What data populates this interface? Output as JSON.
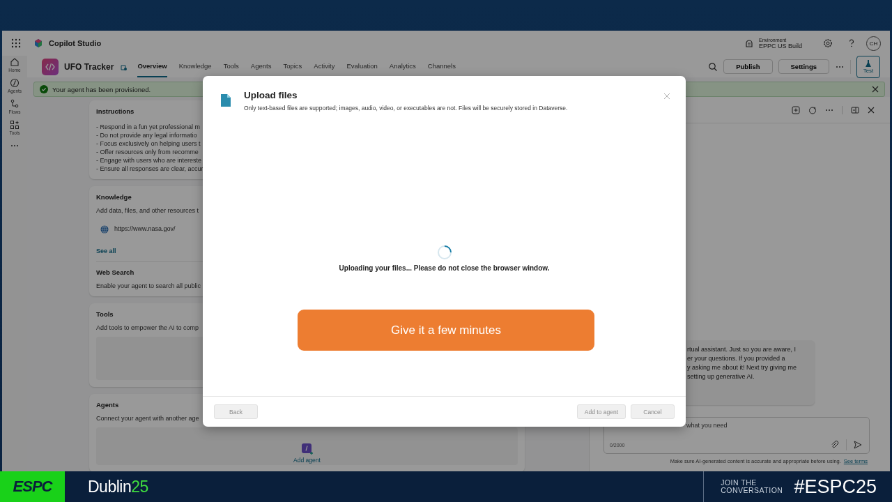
{
  "app_bar": {
    "title": "Copilot Studio",
    "environment_label": "Environment",
    "environment": "EPPC US Build",
    "avatar": "CH"
  },
  "rail": [
    {
      "label": "Home"
    },
    {
      "label": "Agents"
    },
    {
      "label": "Flows"
    },
    {
      "label": "Tools"
    }
  ],
  "agent": {
    "name": "UFO Tracker"
  },
  "tabs": [
    {
      "label": "Overview",
      "selected": true
    },
    {
      "label": "Knowledge",
      "selected": false
    },
    {
      "label": "Tools",
      "selected": false
    },
    {
      "label": "Agents",
      "selected": false
    },
    {
      "label": "Topics",
      "selected": false
    },
    {
      "label": "Activity",
      "selected": false
    },
    {
      "label": "Evaluation",
      "selected": false
    },
    {
      "label": "Analytics",
      "selected": false
    },
    {
      "label": "Channels",
      "selected": false
    }
  ],
  "toolbar": {
    "buttons": [
      "Publish",
      "Settings"
    ],
    "test": "Test"
  },
  "notice": {
    "text": "Your agent has been provisioned."
  },
  "instructions": {
    "title": "Instructions",
    "lines": [
      "- Respond in a fun yet professional m",
      "- Do not provide any legal informatio",
      "- Focus exclusively on helping users t",
      "- Offer resources only from recomme",
      "- Engage with users who are intereste",
      "- Ensure all responses are clear, accur"
    ]
  },
  "knowledge": {
    "title": "Knowledge",
    "description": "Add data, files, and other resources t",
    "source": "https://www.nasa.gov/",
    "link": "See all"
  },
  "web_search": {
    "title": "Web Search",
    "description": "Enable your agent to search all public"
  },
  "tools": {
    "title": "Tools",
    "description": "Add tools to empower the AI to comp"
  },
  "agents": {
    "title": "Agents",
    "description": "Connect your agent with another age",
    "add": "Add agent"
  },
  "chat": {
    "message_lines": [
      "rtual assistant. Just so you are aware, I",
      "er your questions. If you provided a",
      "y asking me about it! Next try giving me",
      "setting up generative AI."
    ],
    "placeholder": "what you need",
    "counter": "0/2000",
    "disclaimer": "Make sure AI-generated content is accurate and appropriate before using.",
    "terms": "See terms"
  },
  "dialog": {
    "title": "Upload files",
    "subtitle": "Only text-based files are supported; images, audio, video, or executables are not. Files will be securely stored in Dataverse.",
    "status": "Uploading your files... Please do not close the browser window.",
    "buttons": [
      {
        "label": "Back",
        "disabled": true
      },
      {
        "label": "Add to agent",
        "disabled": true
      },
      {
        "label": "Cancel",
        "disabled": true
      }
    ]
  },
  "callout": {
    "text": "Give it a few minutes"
  },
  "banner": {
    "logo": "ESPC",
    "city": "Dublin",
    "year": "25",
    "join": [
      "JOIN THE",
      "CONVERSATION"
    ],
    "hashtag": "#ESPC25"
  }
}
